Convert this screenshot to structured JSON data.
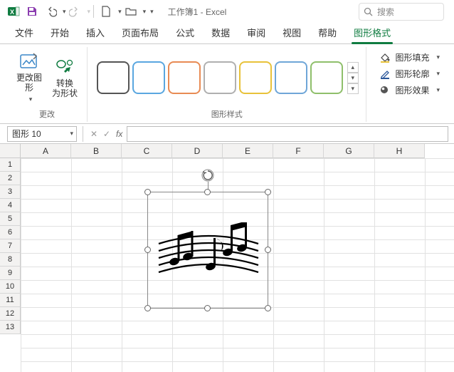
{
  "app": {
    "title": "工作簿1 - Excel"
  },
  "search": {
    "placeholder": "搜索"
  },
  "tabs": {
    "file": "文件",
    "home": "开始",
    "insert": "插入",
    "layout": "页面布局",
    "formula": "公式",
    "data": "数据",
    "review": "审阅",
    "view": "视图",
    "help": "帮助",
    "shapefmt": "图形格式"
  },
  "ribbon": {
    "change_group": "更改",
    "styles_group": "图形样式",
    "change_graphic": "更改图\n形",
    "convert_shape": "转换\n为形状",
    "fill": "图形填充",
    "outline": "图形轮廓",
    "effects": "图形效果",
    "swatch_colors": [
      "#555",
      "#5aa7e0",
      "#e88b54",
      "#b0b0b0",
      "#e8c23a",
      "#6fa6d8",
      "#8fbf6b"
    ]
  },
  "namebox": "图形 10",
  "grid": {
    "cols": [
      "A",
      "B",
      "C",
      "D",
      "E",
      "F",
      "G",
      "H"
    ],
    "rows": [
      "1",
      "2",
      "3",
      "4",
      "5",
      "6",
      "7",
      "8",
      "9",
      "10",
      "11",
      "12",
      "13"
    ]
  },
  "shape": {
    "name": "music-notes-graphic"
  }
}
